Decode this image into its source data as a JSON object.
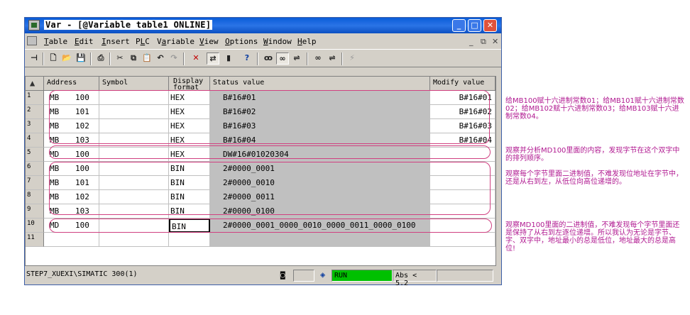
{
  "window": {
    "title": "Var - [@Variable table1  ONLINE]",
    "controls": {
      "min": "_",
      "max": "□",
      "close": "✕"
    }
  },
  "menu": {
    "items": [
      "Table",
      "Edit",
      "Insert",
      "PLC",
      "Variable",
      "View",
      "Options",
      "Window",
      "Help"
    ],
    "mnemonics": [
      "T",
      "E",
      "I",
      "L",
      "a",
      "V",
      "O",
      "W",
      "H"
    ],
    "mdi_controls": [
      "_",
      "⧉",
      "✕"
    ]
  },
  "grid": {
    "columns": [
      "Address",
      "Symbol",
      "Display format",
      "Status value",
      "Modify value"
    ],
    "rows": [
      {
        "n": "1",
        "area": "MB",
        "addr": "100",
        "fmt": "HEX",
        "status": "B#16#01",
        "modify": "B#16#01"
      },
      {
        "n": "2",
        "area": "MB",
        "addr": "101",
        "fmt": "HEX",
        "status": "B#16#02",
        "modify": "B#16#02"
      },
      {
        "n": "3",
        "area": "MB",
        "addr": "102",
        "fmt": "HEX",
        "status": "B#16#03",
        "modify": "B#16#03"
      },
      {
        "n": "4",
        "area": "MB",
        "addr": "103",
        "fmt": "HEX",
        "status": "B#16#04",
        "modify": "B#16#04"
      },
      {
        "n": "5",
        "area": "MD",
        "addr": "100",
        "fmt": "HEX",
        "status": "DW#16#01020304",
        "modify": ""
      },
      {
        "n": "6",
        "area": "MB",
        "addr": "100",
        "fmt": "BIN",
        "status": "2#0000_0001",
        "modify": ""
      },
      {
        "n": "7",
        "area": "MB",
        "addr": "101",
        "fmt": "BIN",
        "status": "2#0000_0010",
        "modify": ""
      },
      {
        "n": "8",
        "area": "MB",
        "addr": "102",
        "fmt": "BIN",
        "status": "2#0000_0011",
        "modify": ""
      },
      {
        "n": "9",
        "area": "MB",
        "addr": "103",
        "fmt": "BIN",
        "status": "2#0000_0100",
        "modify": ""
      },
      {
        "n": "10",
        "area": "MD",
        "addr": "100",
        "fmt": "BIN",
        "status": "2#0000_0001_0000_0010_0000_0011_0000_0100",
        "modify": ""
      },
      {
        "n": "11",
        "area": "",
        "addr": "",
        "fmt": "",
        "status": "",
        "modify": ""
      }
    ]
  },
  "statusbar": {
    "path": "STEP7_XUEXI\\SIMATIC 300(1)",
    "mode": "RUN",
    "abs": "Abs < 5.2"
  },
  "annotations": [
    "给MB100赋十六进制常数01；给MB101赋十六进制常数02；给MB102赋十六进制常数03；给MB103赋十六进制常数04。",
    "观察并分析MD100里面的内容，发现字节在这个双字中的排列顺序。",
    "观察每个字节里面二进制值，不难发现位地址在字节中，还是从右到左，从低位向高位递增的。",
    "观察MD100里面的二进制值，不难发现每个字节里面还是保持了从右到左逐位递增。所以我认为无论是字节、字、双字中，地址最小的总是低位，地址最大的总是高位!"
  ],
  "colors": {
    "title_bar": "#0a5cd8",
    "run": "#00c000",
    "annotation": "#b01890",
    "status_bg": "#c0c0c0"
  }
}
